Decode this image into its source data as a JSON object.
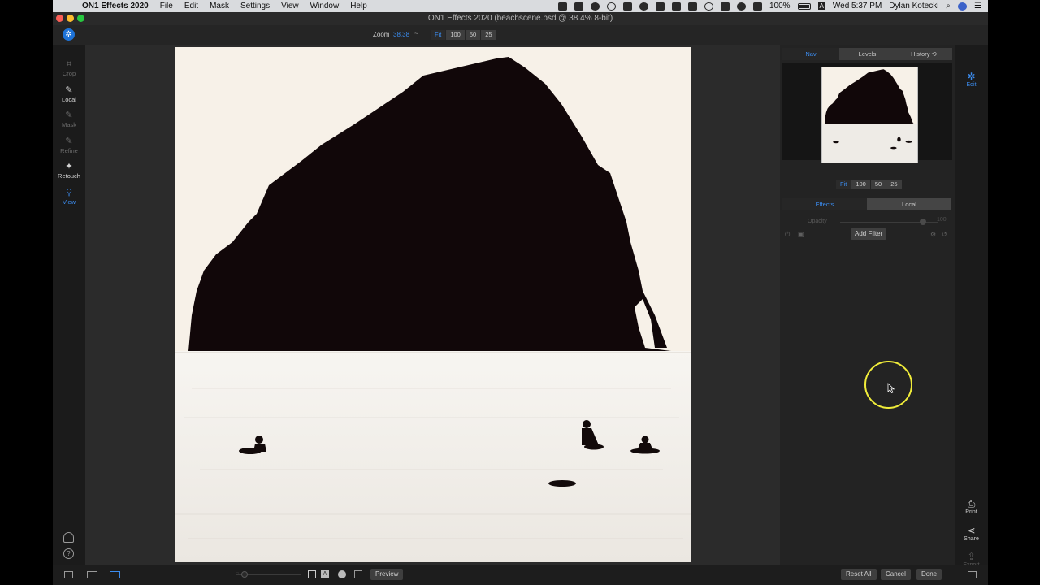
{
  "menubar": {
    "app_name": "ON1 Effects 2020",
    "items": [
      "File",
      "Edit",
      "Mask",
      "Settings",
      "View",
      "Window",
      "Help"
    ],
    "battery": "100%",
    "input_source": "A",
    "clock": "Wed 5:37 PM",
    "user": "Dylan Kotecki"
  },
  "window": {
    "title": "ON1 Effects 2020 (beachscene.psd @ 38.4% 8-bit)"
  },
  "toolbar": {
    "zoom_label": "Zoom",
    "zoom_value": "38.38",
    "zoom_caret": "~",
    "zoom_buttons": [
      "Fit",
      "100",
      "50",
      "25"
    ]
  },
  "left_tools": [
    {
      "label": "Crop",
      "icon": "crop-icon"
    },
    {
      "label": "Local",
      "icon": "brush-icon"
    },
    {
      "label": "Mask",
      "icon": "mask-brush-icon"
    },
    {
      "label": "Refine",
      "icon": "refine-brush-icon"
    },
    {
      "label": "Retouch",
      "icon": "retouch-icon"
    },
    {
      "label": "View",
      "icon": "view-hand-icon"
    }
  ],
  "right_panel": {
    "nav_tabs": [
      "Nav",
      "Levels",
      "History ⟲"
    ],
    "nav_zoom_buttons": [
      "Fit",
      "100",
      "50",
      "25"
    ],
    "layer_tabs": [
      "Effects",
      "Local"
    ],
    "opacity_label": "Opacity",
    "opacity_value": "100",
    "add_filter": "Add Filter"
  },
  "modules": {
    "edit": "Edit",
    "print": "Print",
    "share": "Share",
    "export": "Export"
  },
  "bottom_bar": {
    "preview": "Preview",
    "reset_all": "Reset All",
    "cancel": "Cancel",
    "done": "Done",
    "small_a": "A"
  },
  "colors": {
    "accent": "#3b8cef",
    "panel": "#232323",
    "highlight_ring": "#f0ec3a"
  }
}
